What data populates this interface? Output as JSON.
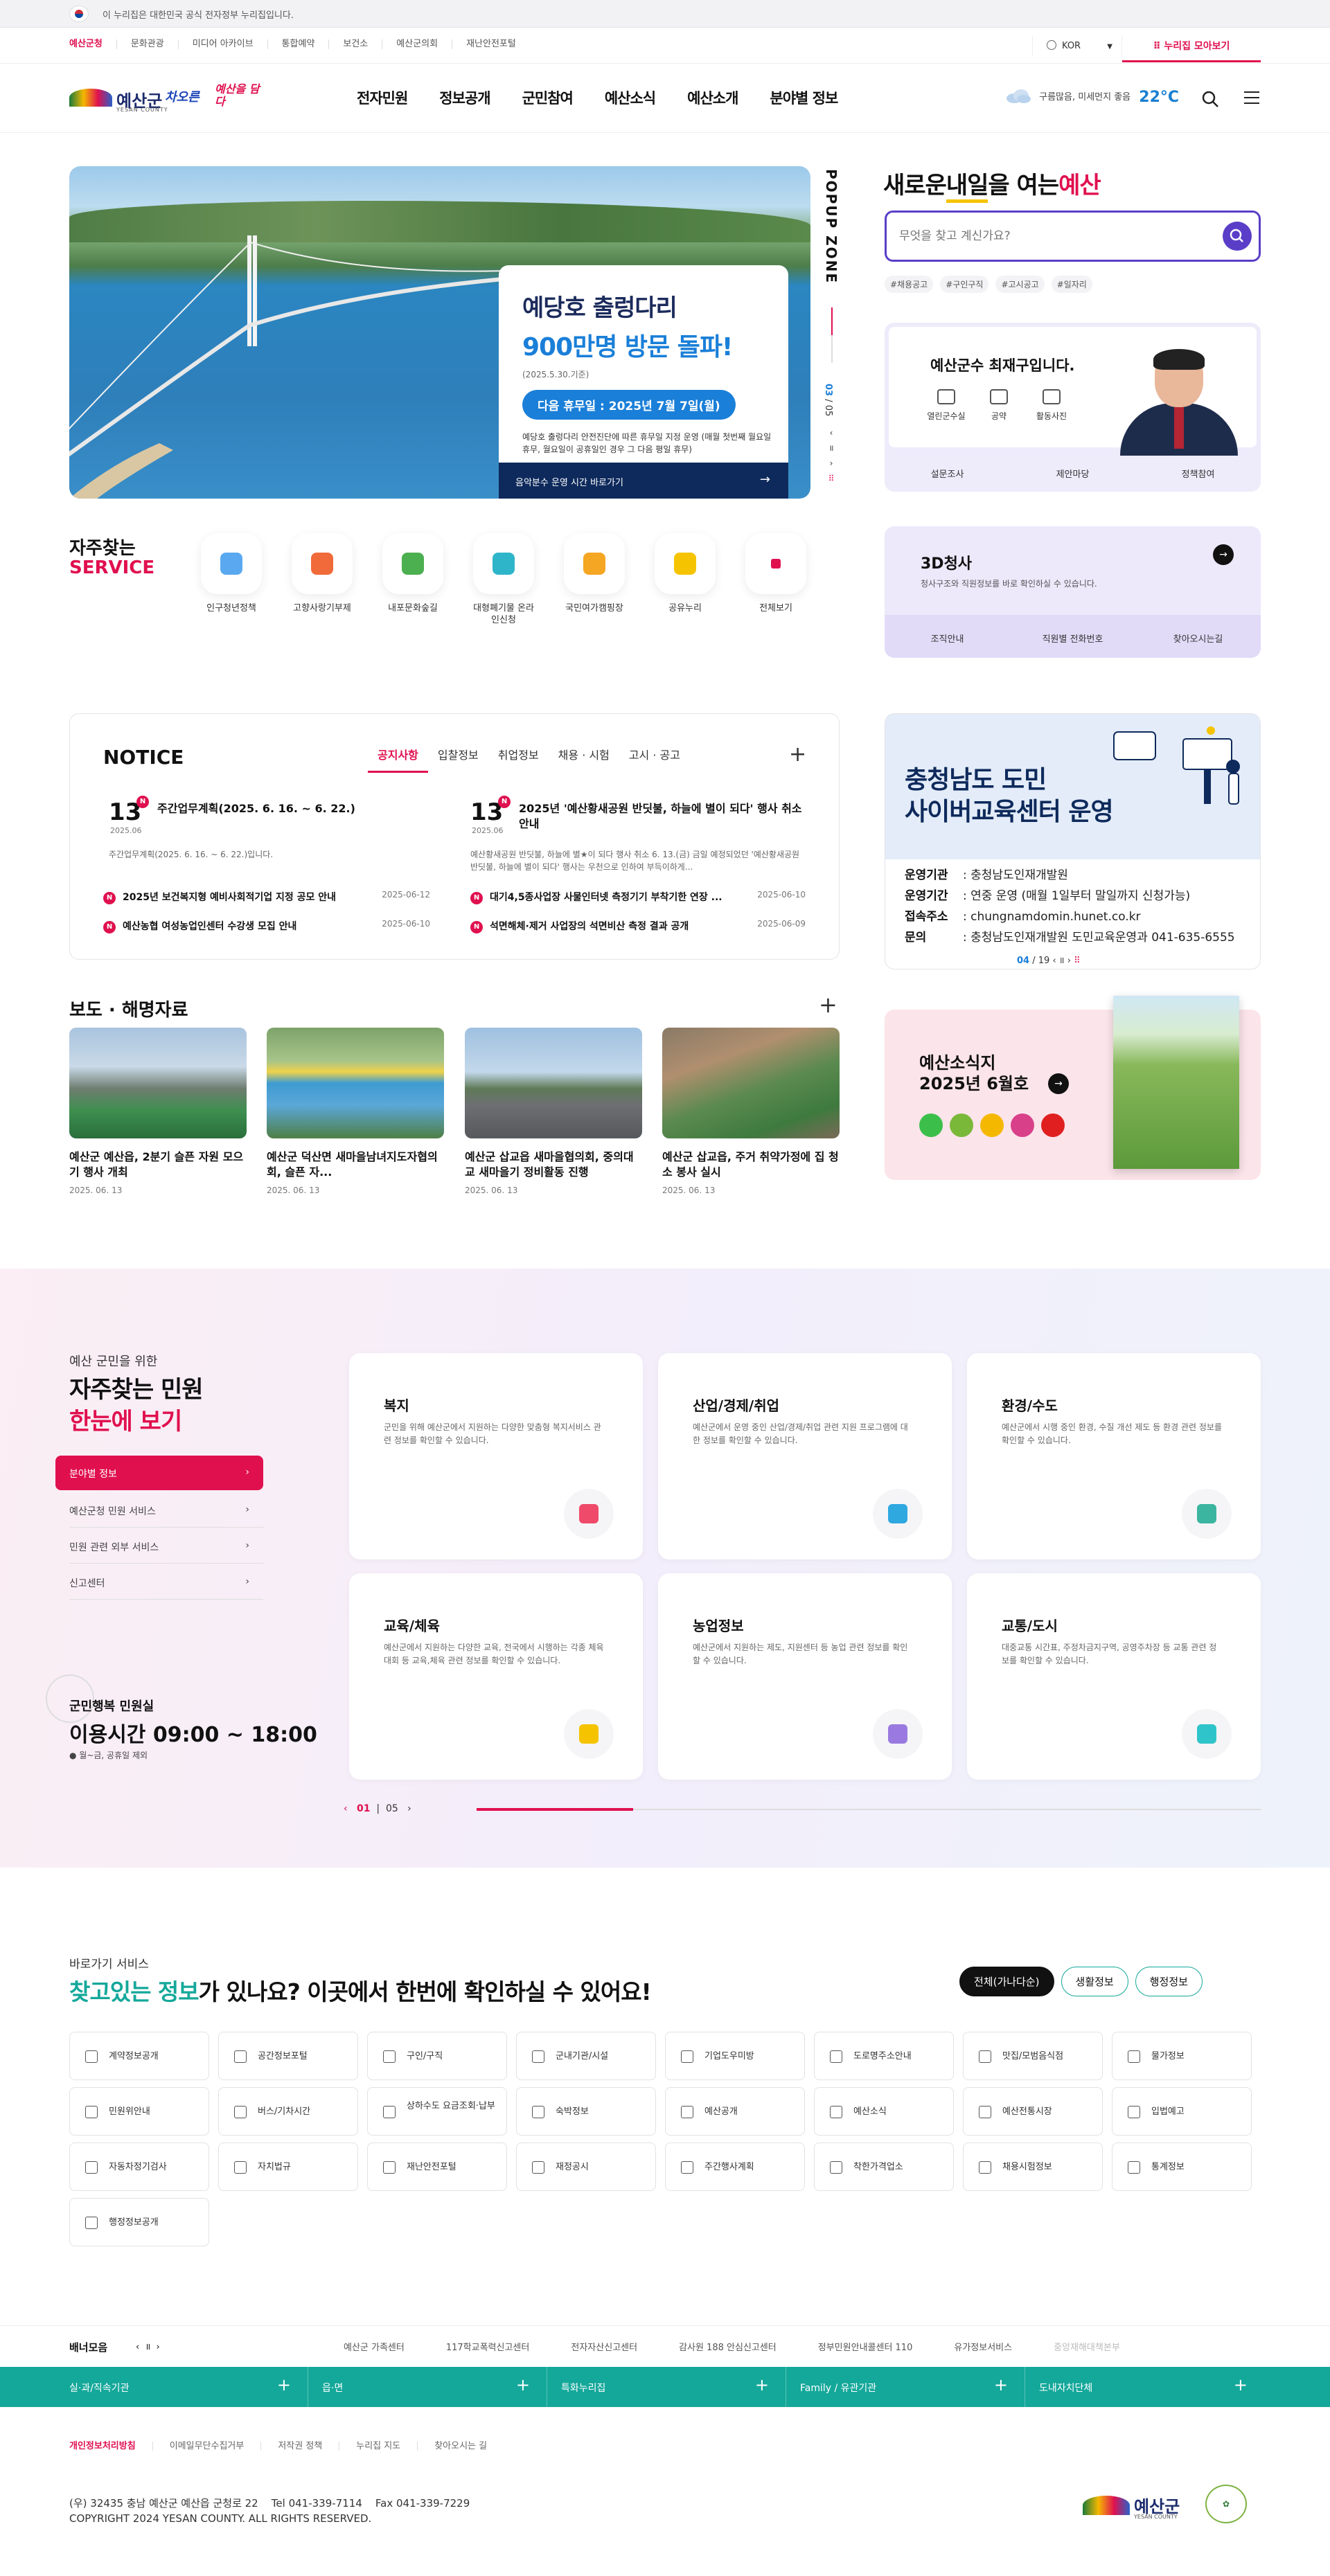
{
  "gov_notice": "이 누리집은 대한민국 공식 전자정부 누리집입니다.",
  "util": {
    "links": [
      "예산군청",
      "문화관광",
      "미디어 아카이브",
      "통합예약",
      "보건소",
      "예산군의회",
      "재난안전포털"
    ],
    "lang": "KOR",
    "more": "누리집 모아보기"
  },
  "header": {
    "logo_name": "예산군",
    "logo_sub": "YESAN COUNTY",
    "slogan1": "차오른",
    "slogan2": "예산을 담다",
    "menu": [
      "전자민원",
      "정보공개",
      "군민참여",
      "예산소식",
      "예산소개",
      "분야별 정보"
    ],
    "weather_text": "구름많음, 미세먼지 좋음",
    "temperature": "22°C"
  },
  "popup": {
    "title1": "예당호 출렁다리",
    "title2": "900만명 방문 돌파!",
    "date": "(2025.5.30.기준)",
    "closed": "다음 휴무일 : 2025년 7월 7일(월)",
    "desc": "예당호 출렁다리 안전진단에 따른 휴무일 지정 운영 (매월 첫번째 월요일 휴무, 월요일이 공휴일인 경우 그 다음 평일 휴무)",
    "bar": "음악분수 운영 시간 바로가기",
    "zone_label": "POPUP ZONE",
    "current": "03",
    "total": "05"
  },
  "search": {
    "slogan_a": "새로운",
    "slogan_b": "내일",
    "slogan_c": "을 여는",
    "slogan_d": "예산",
    "placeholder": "무엇을 찾고 계신가요?",
    "tags": [
      "#채용공고",
      "#구인구직",
      "#고시공고",
      "#일자리"
    ]
  },
  "governor": {
    "title": "예산군수 최재구입니다.",
    "quick": [
      "열린군수실",
      "공약",
      "활동사진"
    ],
    "links": [
      "설문조사",
      "제안마당",
      "정책참여"
    ]
  },
  "c3d": {
    "title": "3D청사",
    "desc": "청사구조와 직원정보를 바로 확인하실 수 있습니다.",
    "links": [
      "조직안내",
      "직원별 전화번호",
      "찾아오시는길"
    ]
  },
  "service": {
    "title1": "자주찾는",
    "title2": "SERVICE",
    "items": [
      {
        "label": "인구청년정책",
        "color": "#5aa9f0"
      },
      {
        "label": "고향사랑기부제",
        "color": "#f06a3a"
      },
      {
        "label": "내포문화숲길",
        "color": "#4caf50"
      },
      {
        "label": "대형폐기물 온라인신청",
        "color": "#2fb5c9"
      },
      {
        "label": "국민여가캠핑장",
        "color": "#f5a623"
      },
      {
        "label": "공유누리",
        "color": "#f5c300"
      },
      {
        "label": "전체보기",
        "color": "#e0104f"
      }
    ]
  },
  "notice": {
    "heading": "NOTICE",
    "tabs": [
      "공지사항",
      "입찰정보",
      "취업정보",
      "채용 · 시험",
      "고시 · 공고"
    ],
    "featured": [
      {
        "day": "13",
        "ym": "2025.06",
        "title": "주간업무계획(2025. 6. 16. ~ 6. 22.)",
        "desc": "주간업무계획(2025. 6. 16. ~ 6. 22.)입니다."
      },
      {
        "day": "13",
        "ym": "2025.06",
        "title": "2025년 '예산황새공원 반딧불, 하늘에 별이 되다' 행사 취소 안내",
        "desc": "예산황새공원 반딧불, 하늘에 별★이 되다 행사 취소 6. 13.(금) 금일 예정되었던 '예산황새공원 반딧불, 하늘에 별이 되다' 행사는 우천으로 인하여 부득이하게..."
      }
    ],
    "rows": [
      {
        "title": "2025년 보건복지형 예비사회적기업 지정 공모 안내",
        "date": "2025-06-12"
      },
      {
        "title": "대기4,5종사업장 사물인터넷 측정기기 부착기한 연장 ...",
        "date": "2025-06-10"
      },
      {
        "title": "예산농협 여성농업인센터 수강생 모집 안내",
        "date": "2025-06-10"
      },
      {
        "title": "석면해체·제거 사업장의 석면비산 측정 결과 공개",
        "date": "2025-06-09"
      }
    ]
  },
  "cyber": {
    "title1": "충청남도 도민",
    "title2": "사이버교육센터 운영",
    "rows": [
      {
        "k": "운영기관",
        "v": "충청남도인재개발원"
      },
      {
        "k": "운영기간",
        "v": "연중 운영 (매월 1일부터 말일까지 신청가능)"
      },
      {
        "k": "접속주소",
        "v": "chungnamdomin.hunet.co.kr"
      },
      {
        "k": "문의",
        "v": "충청남도인재개발원 도민교육운영과 041-635-6555"
      }
    ],
    "current": "04",
    "total": "19"
  },
  "press": {
    "title": "보도 · 해명자료",
    "items": [
      {
        "title": "예산군 예산읍, 2분기 슬픈 자원 모으기 행사 개최",
        "date": "2025. 06. 13"
      },
      {
        "title": "예산군 덕산면 새마을남녀지도자협의회, 슬픈 자...",
        "date": "2025. 06. 13"
      },
      {
        "title": "예산군 삽교읍 새마을협의회, 중의대교 새마을기 정비활동 진행",
        "date": "2025. 06. 13"
      },
      {
        "title": "예산군 삽교읍, 주거 취약가정에 집 청소 봉사 실시",
        "date": "2025. 06. 13"
      }
    ]
  },
  "news": {
    "title1": "예산소식지",
    "title2": "2025년 6월호"
  },
  "civil": {
    "line1": "예산 군민을 위한",
    "line2a": "자주찾는 민원",
    "line2b": "한눈에 보기",
    "selected": "분야별 정보",
    "menu": [
      "예산군청 민원 서비스",
      "민원 관련 외부 서비스",
      "신고센터"
    ],
    "hours_label": "군민행복 민원실",
    "hours": "이용시간 09:00 ~ 18:00",
    "hours_note": "월~금, 공휴일 제외",
    "cards": [
      {
        "title": "복지",
        "desc": "군민을 위해 예산군에서 지원하는 다양한 맞춤형 복지서비스 관련 정보를 확인할 수 있습니다.",
        "color": "#f04a6a"
      },
      {
        "title": "산업/경제/취업",
        "desc": "예산군에서 운영 중인 산업/경제/취업 관련 지원 프로그램에 대한 정보를 확인할 수 있습니다.",
        "color": "#2fa8e0"
      },
      {
        "title": "환경/수도",
        "desc": "예산군에서 시행 중인 환경, 수질 개선 제도 등 환경 관련 정보를 확인할 수 있습니다.",
        "color": "#3bb5a0"
      },
      {
        "title": "교육/체육",
        "desc": "예산군에서 지원하는 다양한 교육, 전국에서 시행하는 각종 체육대회 등 교육,체육 관련 정보를 확인할 수 있습니다.",
        "color": "#f5c300"
      },
      {
        "title": "농업정보",
        "desc": "예산군에서 지원하는 제도, 지원센터 등 농업 관련 정보를 확인할 수 있습니다.",
        "color": "#9a7ae0"
      },
      {
        "title": "교통/도시",
        "desc": "대중교통 시간표, 주정차금지구역, 공영주차장 등 교통 관련 정보를 확인할 수 있습니다.",
        "color": "#2fc4c9"
      }
    ],
    "page_current": "01",
    "page_total": "05"
  },
  "quick": {
    "sub": "바로가기 서비스",
    "title_a": "찾고있는 정보",
    "title_b": "가 있나요? 이곳에서 한번에 확인하실 수 있어요!",
    "buttons": [
      "전체(가나다순)",
      "생활정보",
      "행정정보"
    ],
    "items": [
      "계약정보공개",
      "공간정보포털",
      "구인/구직",
      "군내기관/시설",
      "기업도우미방",
      "도로명주소안내",
      "맛집/모범음식점",
      "물가정보",
      "민원위안내",
      "버스/기차시간",
      "상하수도 요금조회·납부",
      "숙박정보",
      "예산공개",
      "예산소식",
      "예산전통시장",
      "입법예고",
      "자동차정기검사",
      "자치법규",
      "재난안전포털",
      "재정공시",
      "주간행사계획",
      "착한가격업소",
      "채용시험정보",
      "통계정보",
      "행정정보공개"
    ]
  },
  "banner": {
    "label": "배너모음",
    "items": [
      "예산군 가족센터",
      "117학교폭력신고센터",
      "전자자산신고센터",
      "감사원 188 안심신고센터",
      "정부민원안내콜센터 110",
      "유가정보서비스",
      "중앙재해대책본부"
    ]
  },
  "sitebar": [
    "실·과/직속기관",
    "읍·면",
    "특화누리집",
    "Family / 유관기관",
    "도내자치단체"
  ],
  "footer": {
    "links": [
      "개인정보처리방침",
      "이메일무단수집거부",
      "저작권 정책",
      "누리집 지도",
      "찾아오시는 길"
    ],
    "address": "(우) 32435 충남 예산군 예산읍 군청로 22    Tel 041-339-7114    Fax 041-339-7229",
    "copyright": "COPYRIGHT 2024 YESAN COUNTY. ALL RIGHTS RESERVED.",
    "logo": "예산군",
    "logo_sub": "YESAN COUNTY"
  }
}
